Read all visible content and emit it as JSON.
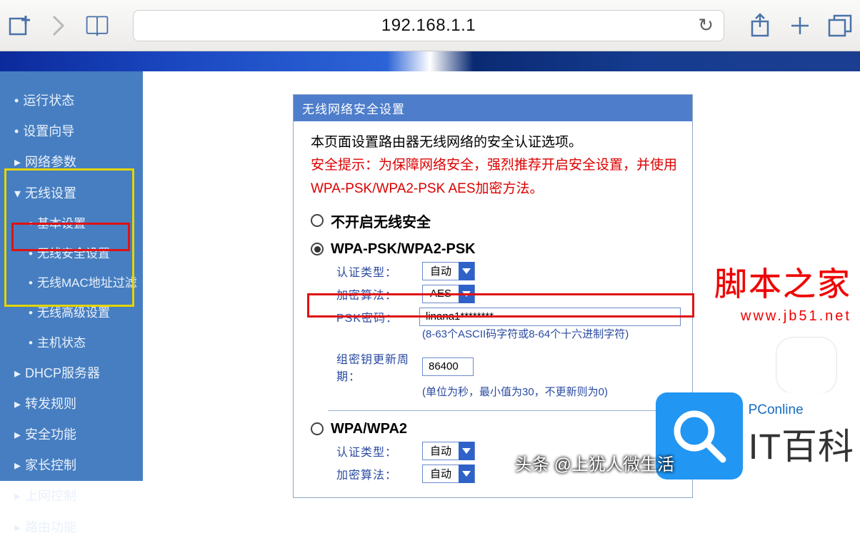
{
  "browser": {
    "url": "192.168.1.1"
  },
  "sidebar": {
    "items": [
      "运行状态",
      "设置向导",
      "网络参数",
      "无线设置",
      "基本设置",
      "无线安全设置",
      "无线MAC地址过滤",
      "无线高级设置",
      "主机状态",
      "DHCP服务器",
      "转发规则",
      "安全功能",
      "家长控制",
      "上网控制",
      "路由功能"
    ]
  },
  "panel": {
    "title": "无线网络安全设置",
    "intro": "本页面设置路由器无线网络的安全认证选项。",
    "warning": "安全提示：为保障网络安全，强烈推荐开启安全设置，并使用WPA-PSK/WPA2-PSK AES加密方法。",
    "opt_none": "不开启无线安全",
    "opt_psk": "WPA-PSK/WPA2-PSK",
    "auth_label": "认证类型：",
    "auth_value": "自动",
    "enc_label": "加密算法：",
    "enc_value": "AES",
    "psk_label": "PSK密码：",
    "psk_value": "linana1********",
    "psk_hint": "(8-63个ASCII码字符或8-64个十六进制字符)",
    "rekey_label": "组密钥更新周期：",
    "rekey_value": "86400",
    "rekey_hint": "(单位为秒，最小值为30，不更新则为0)",
    "opt_wpa": "WPA/WPA2",
    "wpa_auth_label": "认证类型：",
    "wpa_auth_value": "自动",
    "wpa_enc_label": "加密算法：",
    "wpa_enc_value": "自动"
  },
  "watermark": {
    "red_title": "脚本之家",
    "red_url": "www.jb51.net",
    "blue_small": "PConline",
    "blue_big": "IT百科",
    "attrib": "头条 @上犹人微生活"
  }
}
